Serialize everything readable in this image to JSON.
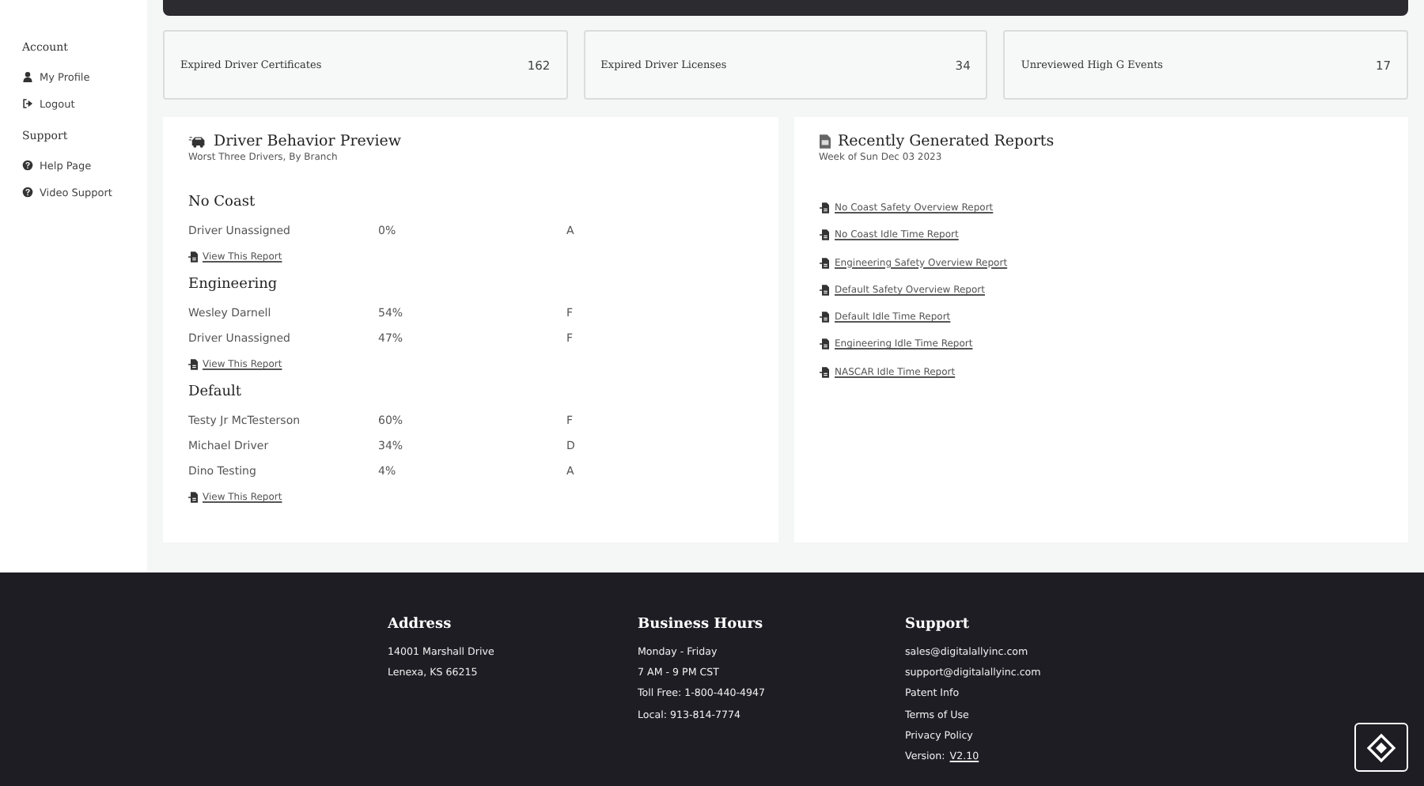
{
  "sidebar": {
    "sections": [
      {
        "title": "Account",
        "items": [
          {
            "label": "My Profile",
            "kind": "user"
          },
          {
            "label": "Logout",
            "kind": "logout"
          }
        ]
      },
      {
        "title": "Support",
        "items": [
          {
            "label": "Help Page",
            "kind": "help"
          },
          {
            "label": "Video Support",
            "kind": "help"
          }
        ]
      }
    ]
  },
  "stats": [
    {
      "label": "Expired Driver Certificates",
      "value": "162"
    },
    {
      "label": "Expired Driver Licenses",
      "value": "34"
    },
    {
      "label": "Unreviewed High G Events",
      "value": "17"
    }
  ],
  "behavior": {
    "title": "Driver Behavior Preview",
    "subtitle": "Worst Three Drivers, By Branch",
    "branches": [
      {
        "name": "No Coast",
        "link": "View This Report",
        "drivers": [
          {
            "name": "Driver Unassigned",
            "score": "0%",
            "grade": "A"
          }
        ]
      },
      {
        "name": "Engineering",
        "link": "View This Report",
        "drivers": [
          {
            "name": "Wesley Darnell",
            "score": "54%",
            "grade": "F"
          },
          {
            "name": "Driver Unassigned",
            "score": "47%",
            "grade": "F"
          }
        ]
      },
      {
        "name": "Default",
        "link": "View This Report",
        "drivers": [
          {
            "name": "Testy Jr McTesterson",
            "score": "60%",
            "grade": "F"
          },
          {
            "name": "Michael Driver",
            "score": "34%",
            "grade": "D"
          },
          {
            "name": "Dino Testing",
            "score": "4%",
            "grade": "A"
          }
        ]
      }
    ]
  },
  "reports": {
    "title": "Recently Generated Reports",
    "subtitle": "Week of Sun Dec 03 2023",
    "items": [
      "No Coast Safety Overview Report",
      "No Coast Idle Time Report",
      "Engineering Safety Overview Report",
      "Default Safety Overview Report",
      "Default Idle Time Report",
      "Engineering Idle Time Report",
      "NASCAR Idle Time Report"
    ]
  },
  "footer": {
    "columns": [
      {
        "title": "Address",
        "lines": [
          {
            "text": "14001 Marshall Drive"
          },
          {
            "text": "Lenexa, KS 66215"
          }
        ]
      },
      {
        "title": "Business Hours",
        "lines": [
          {
            "text": "Monday - Friday"
          },
          {
            "text": "7 AM - 9 PM CST"
          },
          {
            "text": "Toll Free: 1-800-440-4947"
          },
          {
            "text": "Local: 913-814-7774"
          }
        ]
      },
      {
        "title": "Support",
        "lines": [
          {
            "text": "sales@digitalallyinc.com"
          },
          {
            "text": "support@digitalallyinc.com"
          },
          {
            "text": "Patent Info"
          },
          {
            "text": "Terms of Use"
          },
          {
            "text": "Privacy Policy"
          },
          {
            "text": "Version:",
            "link": "V2.10"
          }
        ]
      }
    ]
  }
}
